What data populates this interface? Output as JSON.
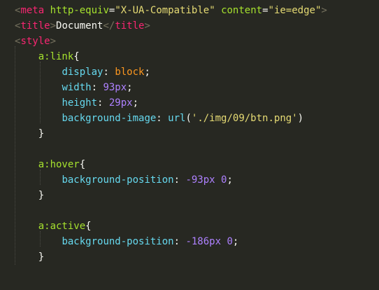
{
  "editor": {
    "theme_background": "#272822",
    "lines": [
      [
        {
          "t": "<",
          "c": "pun"
        },
        {
          "t": "meta",
          "c": "tag"
        },
        {
          "t": " ",
          "c": "txt"
        },
        {
          "t": "http-equiv",
          "c": "attr"
        },
        {
          "t": "=",
          "c": "txt"
        },
        {
          "t": "\"X-UA-Compatible\"",
          "c": "str"
        },
        {
          "t": " ",
          "c": "txt"
        },
        {
          "t": "content",
          "c": "attr"
        },
        {
          "t": "=",
          "c": "txt"
        },
        {
          "t": "\"ie=edge\"",
          "c": "str"
        },
        {
          "t": ">",
          "c": "pun"
        }
      ],
      [
        {
          "t": "<",
          "c": "pun"
        },
        {
          "t": "title",
          "c": "tag"
        },
        {
          "t": ">",
          "c": "pun"
        },
        {
          "t": "Document",
          "c": "txt"
        },
        {
          "t": "</",
          "c": "pun"
        },
        {
          "t": "title",
          "c": "tag"
        },
        {
          "t": ">",
          "c": "pun"
        }
      ],
      [
        {
          "t": "<",
          "c": "pun"
        },
        {
          "t": "style",
          "c": "tag"
        },
        {
          "t": ">",
          "c": "pun"
        }
      ],
      [
        {
          "t": "    ",
          "c": "txt"
        },
        {
          "t": "a:link",
          "c": "sel"
        },
        {
          "t": "{",
          "c": "plain"
        }
      ],
      [
        {
          "t": "        ",
          "c": "txt"
        },
        {
          "t": "display",
          "c": "prop"
        },
        {
          "t": ": ",
          "c": "plain"
        },
        {
          "t": "block",
          "c": "val"
        },
        {
          "t": ";",
          "c": "plain"
        }
      ],
      [
        {
          "t": "        ",
          "c": "txt"
        },
        {
          "t": "width",
          "c": "prop"
        },
        {
          "t": ": ",
          "c": "plain"
        },
        {
          "t": "93px",
          "c": "num"
        },
        {
          "t": ";",
          "c": "plain"
        }
      ],
      [
        {
          "t": "        ",
          "c": "txt"
        },
        {
          "t": "height",
          "c": "prop"
        },
        {
          "t": ": ",
          "c": "plain"
        },
        {
          "t": "29px",
          "c": "num"
        },
        {
          "t": ";",
          "c": "plain"
        }
      ],
      [
        {
          "t": "        ",
          "c": "txt"
        },
        {
          "t": "background-image",
          "c": "prop"
        },
        {
          "t": ": ",
          "c": "plain"
        },
        {
          "t": "url",
          "c": "url"
        },
        {
          "t": "(",
          "c": "plain"
        },
        {
          "t": "'./img/09/btn.png'",
          "c": "str"
        },
        {
          "t": ")",
          "c": "plain"
        }
      ],
      [
        {
          "t": "    ",
          "c": "txt"
        },
        {
          "t": "}",
          "c": "plain"
        }
      ],
      [],
      [
        {
          "t": "    ",
          "c": "txt"
        },
        {
          "t": "a:hover",
          "c": "sel"
        },
        {
          "t": "{",
          "c": "plain"
        }
      ],
      [
        {
          "t": "        ",
          "c": "txt"
        },
        {
          "t": "background-position",
          "c": "prop"
        },
        {
          "t": ": ",
          "c": "plain"
        },
        {
          "t": "-93px 0",
          "c": "num"
        },
        {
          "t": ";",
          "c": "plain"
        }
      ],
      [
        {
          "t": "    ",
          "c": "txt"
        },
        {
          "t": "}",
          "c": "plain"
        }
      ],
      [],
      [
        {
          "t": "    ",
          "c": "txt"
        },
        {
          "t": "a:active",
          "c": "sel"
        },
        {
          "t": "{",
          "c": "plain"
        }
      ],
      [
        {
          "t": "        ",
          "c": "txt"
        },
        {
          "t": "background-position",
          "c": "prop"
        },
        {
          "t": ": ",
          "c": "plain"
        },
        {
          "t": "-186px 0",
          "c": "num"
        },
        {
          "t": ";",
          "c": "plain"
        }
      ],
      [
        {
          "t": "    ",
          "c": "txt"
        },
        {
          "t": "}",
          "c": "plain"
        }
      ]
    ]
  }
}
